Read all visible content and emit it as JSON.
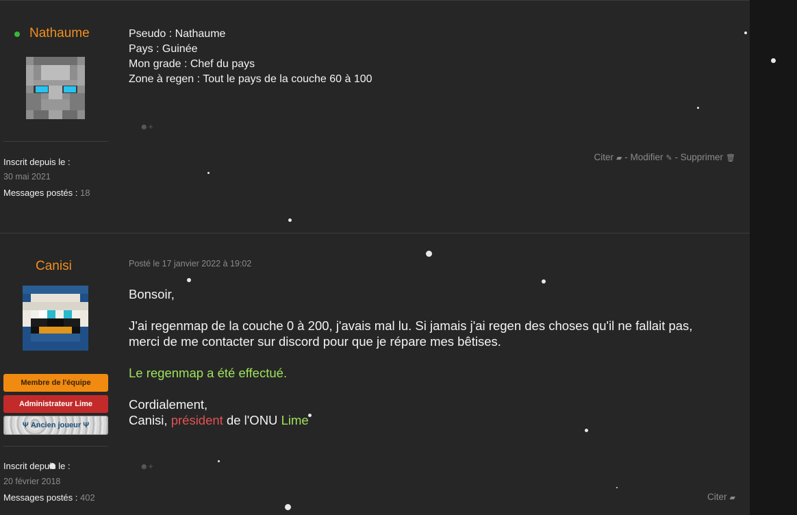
{
  "posts": [
    {
      "author": "Nathaume",
      "content_lines": [
        "Pseudo : Nathaume",
        "Pays : Guinée",
        "Mon grade : Chef du pays",
        "Zone à regen : Tout le pays de la couche 60 à 100"
      ],
      "member_since_label": "Inscrit depuis le :",
      "member_since": "30 mai 2021",
      "messages_label": "Messages postés :",
      "messages_count": "18",
      "actions": {
        "quote": "Citer",
        "sep1": "-",
        "edit": "Modifier",
        "sep2": "-",
        "delete": "Supprimer"
      }
    },
    {
      "author": "Canisi",
      "date": "Posté le 17 janvier 2022 à 19:02",
      "greeting": "Bonsoir,",
      "body_line1": "J'ai regenmap de la couche 0 à 200, j'avais mal lu. Si jamais j'ai regen des choses qu'il ne fallait pas,",
      "body_line2": "merci de me contacter sur discord pour que je répare mes bêtises.",
      "done": "Le regenmap a été effectué.",
      "closing": "Cordialement,",
      "sig_name": "Canisi, ",
      "sig_role": "président",
      "sig_mid": " de l'ONU ",
      "sig_brand": "Lime",
      "badges": {
        "team": "Membre de l'équipe",
        "admin": "Administrateur Lime",
        "old": "Ψ Ancien joueur Ψ"
      },
      "member_since_label": "Inscrit depuis le :",
      "member_since": "20 février 2018",
      "messages_label": "Messages postés :",
      "messages_count": "402",
      "actions": {
        "quote": "Citer"
      }
    }
  ],
  "colors": {
    "author": "#f0901e",
    "online": "#3bb43b",
    "highlight_green": "#9fe35a",
    "highlight_red": "#e25252"
  }
}
